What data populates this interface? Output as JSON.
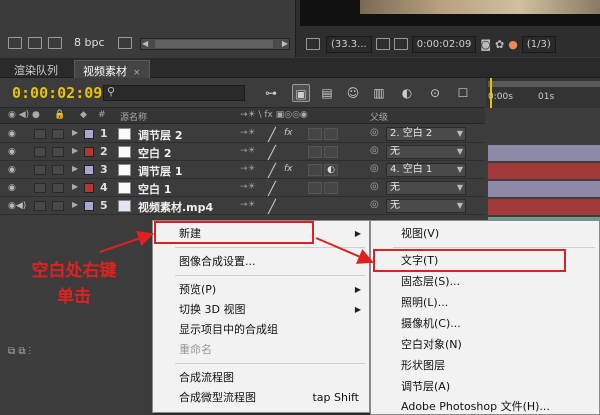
{
  "top_panel": {
    "bit_depth": "8 bpc",
    "zoom": "(33.3...",
    "timecode": "0:00:02:09",
    "resolution": "(1/3)"
  },
  "tabs": [
    {
      "label": "渲染队列"
    },
    {
      "label": "视频素材"
    }
  ],
  "timeline": {
    "current_time": "0:00:02:09",
    "search_placeholder": "",
    "ruler_labels": [
      "0:00s",
      "01s"
    ],
    "column_headers": {
      "source_name": "源名称",
      "parent": "父级"
    },
    "layers": [
      {
        "num": "1",
        "name": "调节层 2",
        "label_color": "#a9a6d1",
        "parent": "2. 空白 2",
        "bar_color": "#8d8aa8",
        "adjustment": true,
        "fx": true
      },
      {
        "num": "2",
        "name": "空白 2",
        "label_color": "#b23838",
        "parent": "无",
        "bar_color": "#a33a3a",
        "adjustment": false,
        "fx": false
      },
      {
        "num": "3",
        "name": "调节层 1",
        "label_color": "#a9a6d1",
        "parent": "4. 空白 1",
        "bar_color": "#8d8aa8",
        "adjustment": true,
        "fx": true
      },
      {
        "num": "4",
        "name": "空白 1",
        "label_color": "#b23838",
        "parent": "无",
        "bar_color": "#a33a3a",
        "adjustment": false,
        "fx": false
      },
      {
        "num": "5",
        "name": "视频素材.mp4",
        "label_color": "#a9a6d1",
        "parent": "无",
        "bar_color": "#6e9a8f",
        "adjustment": false,
        "fx": false
      }
    ]
  },
  "context_menu": {
    "items": [
      {
        "label": "新建",
        "submenu": true
      },
      {
        "label": "图像合成设置...",
        "submenu": false
      },
      {
        "label": "预览(P)",
        "submenu": true
      },
      {
        "label": "切换 3D 视图",
        "submenu": true
      },
      {
        "label": "显示项目中的合成组",
        "submenu": false
      },
      {
        "label": "重命名",
        "submenu": false,
        "disabled": true
      },
      {
        "label": "合成流程图",
        "submenu": false
      },
      {
        "label": "合成微型流程图",
        "submenu": false,
        "shortcut": "tap Shift"
      }
    ]
  },
  "submenu": {
    "items": [
      {
        "label": "视图(V)"
      },
      {
        "label": "文字(T)"
      },
      {
        "label": "固态层(S)..."
      },
      {
        "label": "照明(L)..."
      },
      {
        "label": "摄像机(C)..."
      },
      {
        "label": "空白对象(N)"
      },
      {
        "label": "形状图层"
      },
      {
        "label": "调节层(A)"
      },
      {
        "label": "Adobe Photoshop 文件(H)..."
      }
    ]
  },
  "annotation": {
    "line1": "空白处右键",
    "line2": "单击",
    "color": "#e02020"
  }
}
